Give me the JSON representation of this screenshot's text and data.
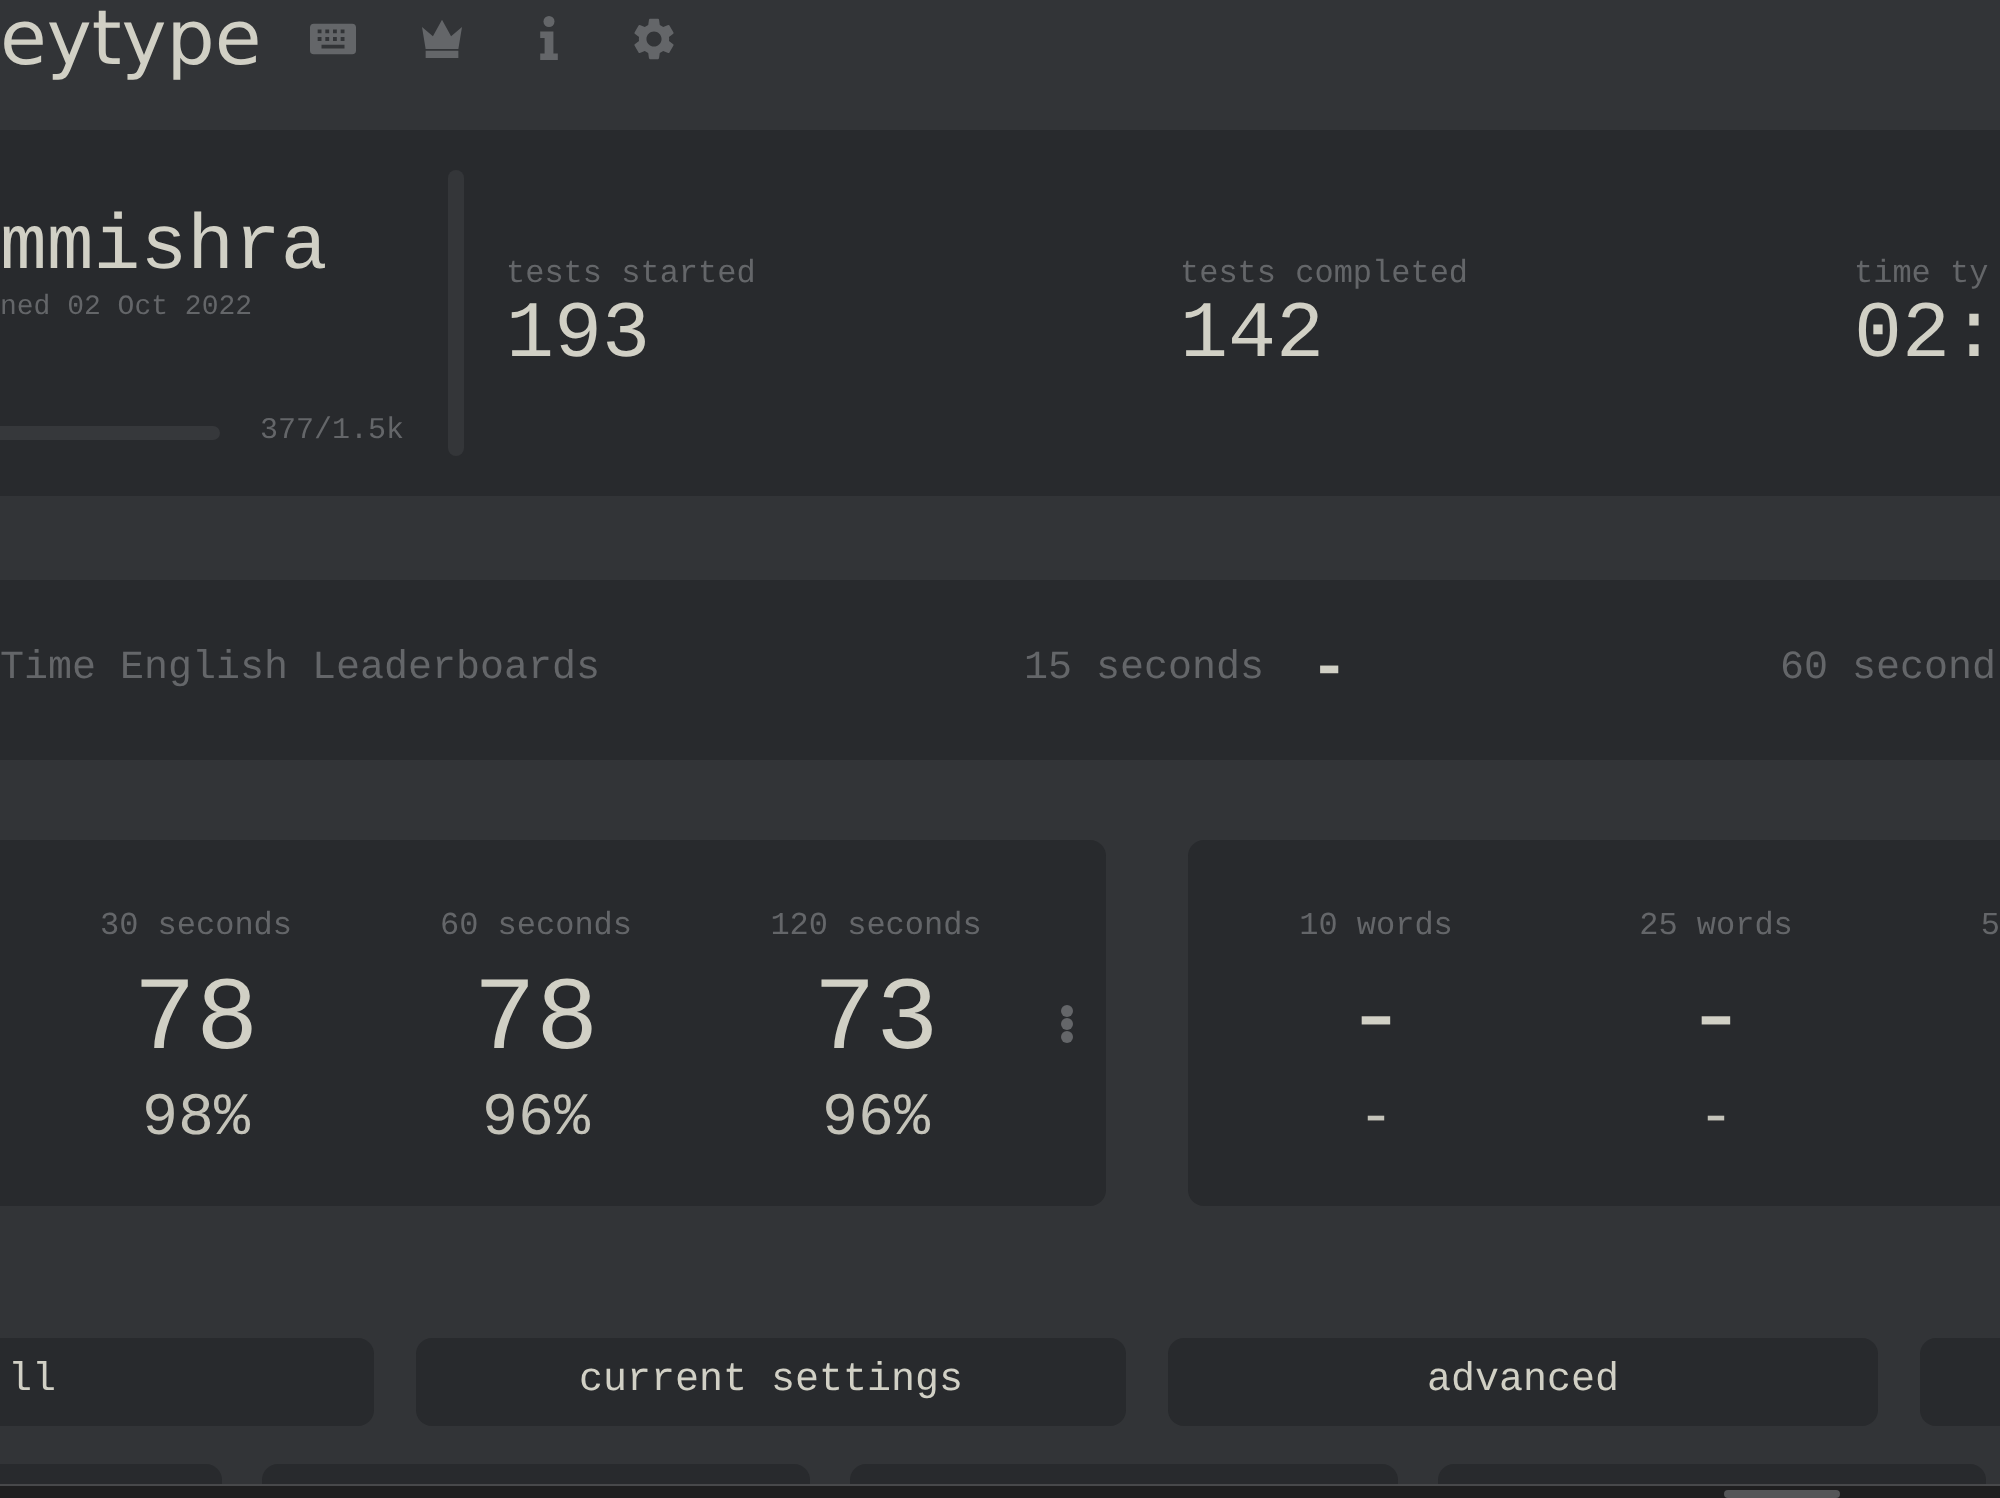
{
  "header": {
    "logo": "eytype"
  },
  "profile": {
    "name": "mmishra",
    "joined": "ned 02 Oct 2022",
    "xp": "377/1.5k",
    "stats": [
      {
        "label": "tests started",
        "value": "193"
      },
      {
        "label": "tests completed",
        "value": "142"
      },
      {
        "label": "time ty",
        "value": "02:"
      }
    ]
  },
  "leaderboards": {
    "title": "Time English Leaderboards",
    "entries": [
      {
        "label": "15 seconds",
        "rank": "-"
      },
      {
        "label": "60 second"
      }
    ]
  },
  "personal_bests": [
    {
      "columns": [
        {
          "label": "30 seconds",
          "wpm": "78",
          "acc": "98%"
        },
        {
          "label": "60 seconds",
          "wpm": "78",
          "acc": "96%"
        },
        {
          "label": "120 seconds",
          "wpm": "73",
          "acc": "96%"
        }
      ]
    },
    {
      "columns": [
        {
          "label": "10 words",
          "wpm": "-",
          "acc": "-"
        },
        {
          "label": "25 words",
          "wpm": "-",
          "acc": "-"
        },
        {
          "label": "5"
        }
      ]
    }
  ],
  "filter_buttons": [
    "ll",
    "current settings",
    "advanced"
  ]
}
